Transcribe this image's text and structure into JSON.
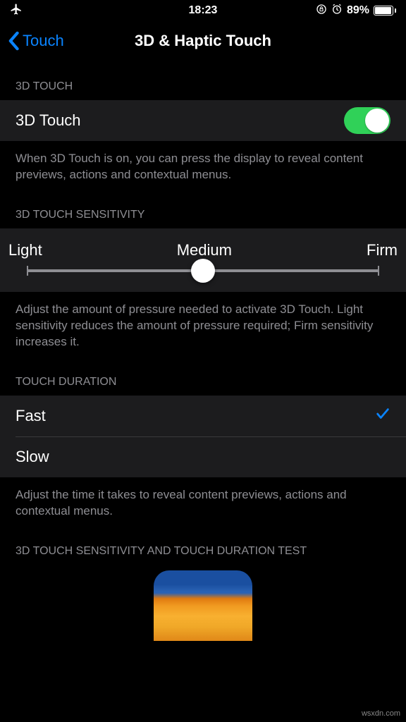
{
  "statusbar": {
    "time": "18:23",
    "airplane_icon": "airplane-icon",
    "lock_icon": "orientation-lock-icon",
    "alarm_icon": "alarm-icon",
    "battery_pct": "89%"
  },
  "nav": {
    "back_label": "Touch",
    "title": "3D & Haptic Touch"
  },
  "sections": {
    "s1_header": "3D TOUCH",
    "toggle": {
      "label": "3D Touch",
      "on": true
    },
    "s1_footer": "When 3D Touch is on, you can press the display to reveal content previews, actions and contextual menus.",
    "s2_header": "3D TOUCH SENSITIVITY",
    "slider": {
      "left": "Light",
      "mid": "Medium",
      "right": "Firm",
      "value": 0.5
    },
    "s2_footer": "Adjust the amount of pressure needed to activate 3D Touch. Light sensitivity reduces the amount of pressure required; Firm sensitivity increases it.",
    "s3_header": "TOUCH DURATION",
    "duration": {
      "fast": "Fast",
      "slow": "Slow",
      "selected": "fast"
    },
    "s3_footer": "Adjust the time it takes to reveal content previews, actions and contextual menus.",
    "s4_header": "3D TOUCH SENSITIVITY AND TOUCH DURATION TEST"
  },
  "watermark": "wsxdn.com"
}
